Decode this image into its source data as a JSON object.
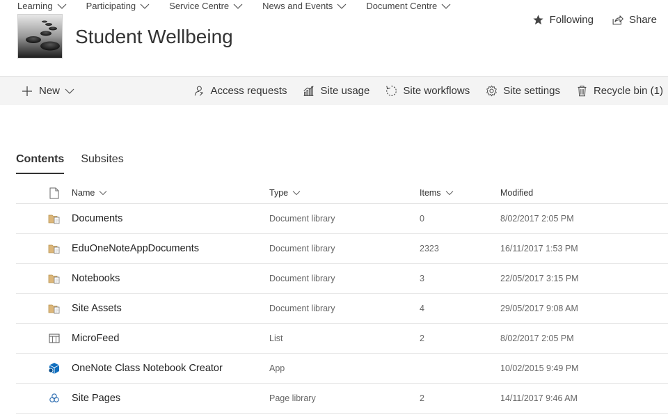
{
  "topnav": {
    "items": [
      {
        "label": "Learning"
      },
      {
        "label": "Participating"
      },
      {
        "label": "Service Centre"
      },
      {
        "label": "News and Events"
      },
      {
        "label": "Document Centre"
      }
    ]
  },
  "site": {
    "title": "Student Wellbeing"
  },
  "header_actions": {
    "following_label": "Following",
    "share_label": "Share"
  },
  "commandbar": {
    "new_label": "New",
    "access_requests_label": "Access requests",
    "site_usage_label": "Site usage",
    "site_workflows_label": "Site workflows",
    "site_settings_label": "Site settings",
    "recycle_bin_label": "Recycle bin (1)"
  },
  "tabs": [
    {
      "label": "Contents",
      "active": true
    },
    {
      "label": "Subsites",
      "active": false
    }
  ],
  "table": {
    "columns": {
      "name": "Name",
      "type": "Type",
      "items": "Items",
      "modified": "Modified"
    },
    "rows": [
      {
        "icon": "document-library-icon",
        "name": "Documents",
        "type": "Document library",
        "items": "0",
        "modified": "8/02/2017 2:05 PM"
      },
      {
        "icon": "document-library-icon",
        "name": "EduOneNoteAppDocuments",
        "type": "Document library",
        "items": "2323",
        "modified": "16/11/2017 1:53 PM"
      },
      {
        "icon": "document-library-icon",
        "name": "Notebooks",
        "type": "Document library",
        "items": "3",
        "modified": "22/05/2017 3:15 PM"
      },
      {
        "icon": "document-library-icon",
        "name": "Site Assets",
        "type": "Document library",
        "items": "4",
        "modified": "29/05/2017 9:08 AM"
      },
      {
        "icon": "list-icon",
        "name": "MicroFeed",
        "type": "List",
        "items": "2",
        "modified": "8/02/2017 2:05 PM"
      },
      {
        "icon": "app-icon",
        "name": "OneNote Class Notebook Creator",
        "type": "App",
        "items": "",
        "modified": "10/02/2015 9:49 PM"
      },
      {
        "icon": "page-library-icon",
        "name": "Site Pages",
        "type": "Page library",
        "items": "2",
        "modified": "14/11/2017 9:46 AM"
      }
    ]
  },
  "colors": {
    "commandbar_bg": "#f4f4f4",
    "folder_yellow": "#dcb67a",
    "app_blue": "#106ebe"
  }
}
